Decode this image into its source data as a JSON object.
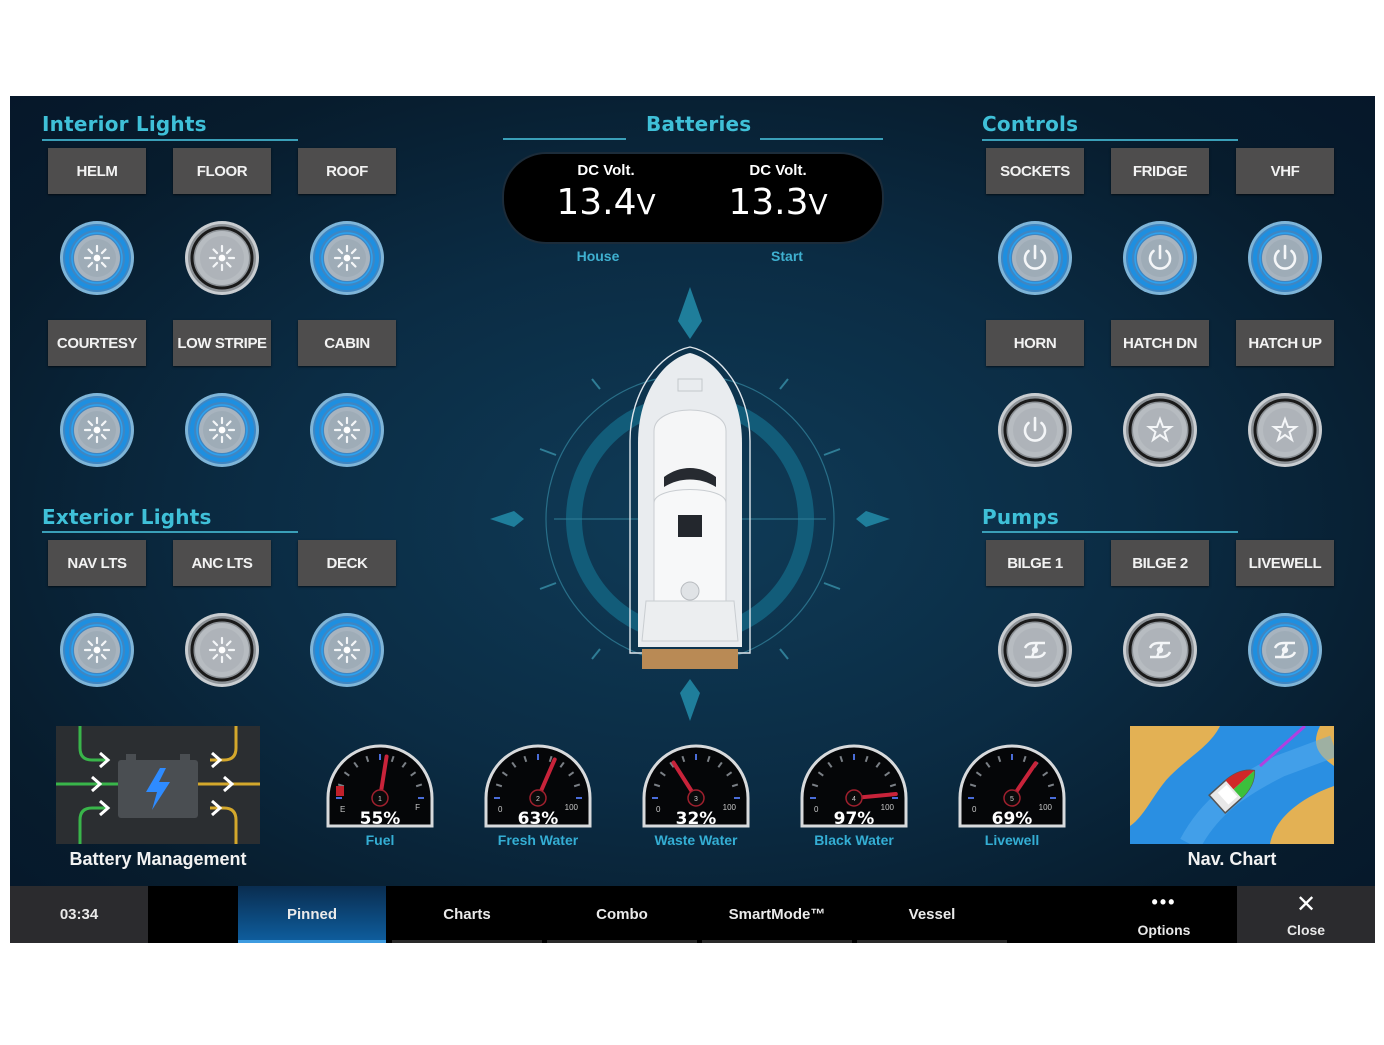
{
  "sections": {
    "interior_lights": {
      "title": "Interior Lights"
    },
    "exterior_lights": {
      "title": "Exterior Lights"
    },
    "batteries": {
      "title": "Batteries"
    },
    "controls": {
      "title": "Controls"
    },
    "pumps": {
      "title": "Pumps"
    }
  },
  "interior_lights": [
    {
      "label": "HELM",
      "state": "on",
      "icon": "light-icon"
    },
    {
      "label": "FLOOR",
      "state": "off",
      "icon": "light-icon"
    },
    {
      "label": "ROOF",
      "state": "on",
      "icon": "light-icon"
    },
    {
      "label": "COURTESY",
      "state": "on",
      "icon": "light-icon"
    },
    {
      "label": "LOW STRIPE",
      "state": "on",
      "icon": "light-icon"
    },
    {
      "label": "CABIN",
      "state": "on",
      "icon": "light-icon"
    }
  ],
  "exterior_lights": [
    {
      "label": "NAV LTS",
      "state": "on",
      "icon": "light-icon"
    },
    {
      "label": "ANC LTS",
      "state": "off",
      "icon": "light-icon"
    },
    {
      "label": "DECK",
      "state": "on",
      "icon": "light-icon"
    }
  ],
  "controls": [
    {
      "label": "SOCKETS",
      "state": "on",
      "icon": "power-icon"
    },
    {
      "label": "FRIDGE",
      "state": "on",
      "icon": "power-icon"
    },
    {
      "label": "VHF",
      "state": "on",
      "icon": "power-icon"
    },
    {
      "label": "HORN",
      "state": "off",
      "icon": "power-icon"
    },
    {
      "label": "HATCH DN",
      "state": "off",
      "icon": "star-icon"
    },
    {
      "label": "HATCH UP",
      "state": "off",
      "icon": "star-icon"
    }
  ],
  "pumps": [
    {
      "label": "BILGE 1",
      "state": "off",
      "icon": "pump-icon"
    },
    {
      "label": "BILGE 2",
      "state": "off",
      "icon": "pump-icon"
    },
    {
      "label": "LIVEWELL",
      "state": "on",
      "icon": "pump-icon"
    }
  ],
  "batteries": [
    {
      "caption": "DC Volt.",
      "value": "13.4",
      "unit": "V",
      "name": "House"
    },
    {
      "caption": "DC Volt.",
      "value": "13.3",
      "unit": "V",
      "name": "Start"
    }
  ],
  "tanks": [
    {
      "name": "Fuel",
      "percent": 55,
      "display": "55%",
      "number": "1",
      "min_label": "E",
      "max_label": "F"
    },
    {
      "name": "Fresh Water",
      "percent": 63,
      "display": "63%",
      "number": "2",
      "min_label": "0",
      "max_label": "100"
    },
    {
      "name": "Waste Water",
      "percent": 32,
      "display": "32%",
      "number": "3",
      "min_label": "0",
      "max_label": "100"
    },
    {
      "name": "Black Water",
      "percent": 97,
      "display": "97%",
      "number": "4",
      "min_label": "0",
      "max_label": "100"
    },
    {
      "name": "Livewell",
      "percent": 69,
      "display": "69%",
      "number": "5",
      "min_label": "0",
      "max_label": "100"
    }
  ],
  "tiles": {
    "battery_management": "Battery Management",
    "nav_chart": "Nav. Chart"
  },
  "bottom_bar": {
    "time": "03:34",
    "tabs": [
      {
        "label": "Pinned",
        "active": true
      },
      {
        "label": "Charts",
        "active": false
      },
      {
        "label": "Combo",
        "active": false
      },
      {
        "label": "SmartMode™",
        "active": false
      },
      {
        "label": "Vessel",
        "active": false
      }
    ],
    "options_label": "Options",
    "close_label": "Close"
  },
  "colors": {
    "accent": "#3fc0d8",
    "on_ring": "#1e8fe0",
    "gauge_needle": "#c8233a",
    "button_bg": "#4e4d4d",
    "active_tab": "#0e5fa0"
  }
}
